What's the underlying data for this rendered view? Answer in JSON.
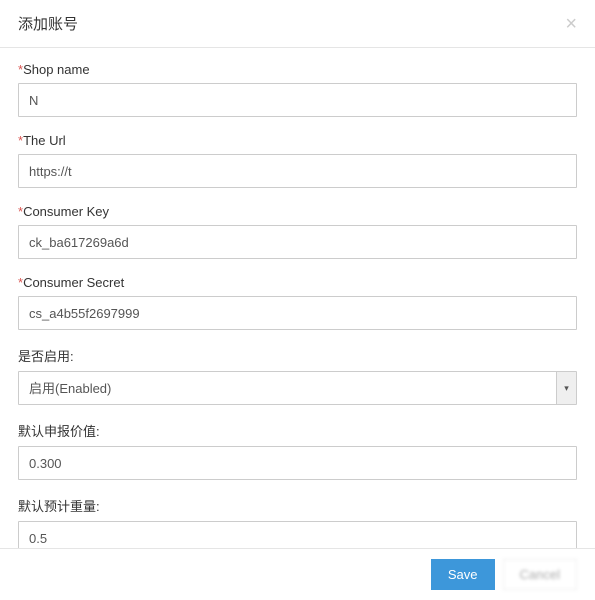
{
  "modal": {
    "title": "添加账号",
    "close_symbol": "×"
  },
  "form": {
    "shop_name": {
      "label": "Shop name",
      "required": true,
      "value": "N"
    },
    "the_url": {
      "label": "The Url",
      "required": true,
      "value": "https://t"
    },
    "consumer_key": {
      "label": "Consumer Key",
      "required": true,
      "value": "ck_ba617269a6d"
    },
    "consumer_secret": {
      "label": "Consumer Secret",
      "required": true,
      "value": "cs_a4b55f2697999"
    },
    "enable": {
      "label": "是否启用:",
      "value": "启用(Enabled)"
    },
    "declared_value": {
      "label": "默认申报价值:",
      "value": "0.300"
    },
    "estimated_weight": {
      "label": "默认预计重量:",
      "value": "0.5"
    }
  },
  "footer": {
    "save_label": "Save",
    "cancel_label": "Cancel"
  },
  "required_star": "*"
}
